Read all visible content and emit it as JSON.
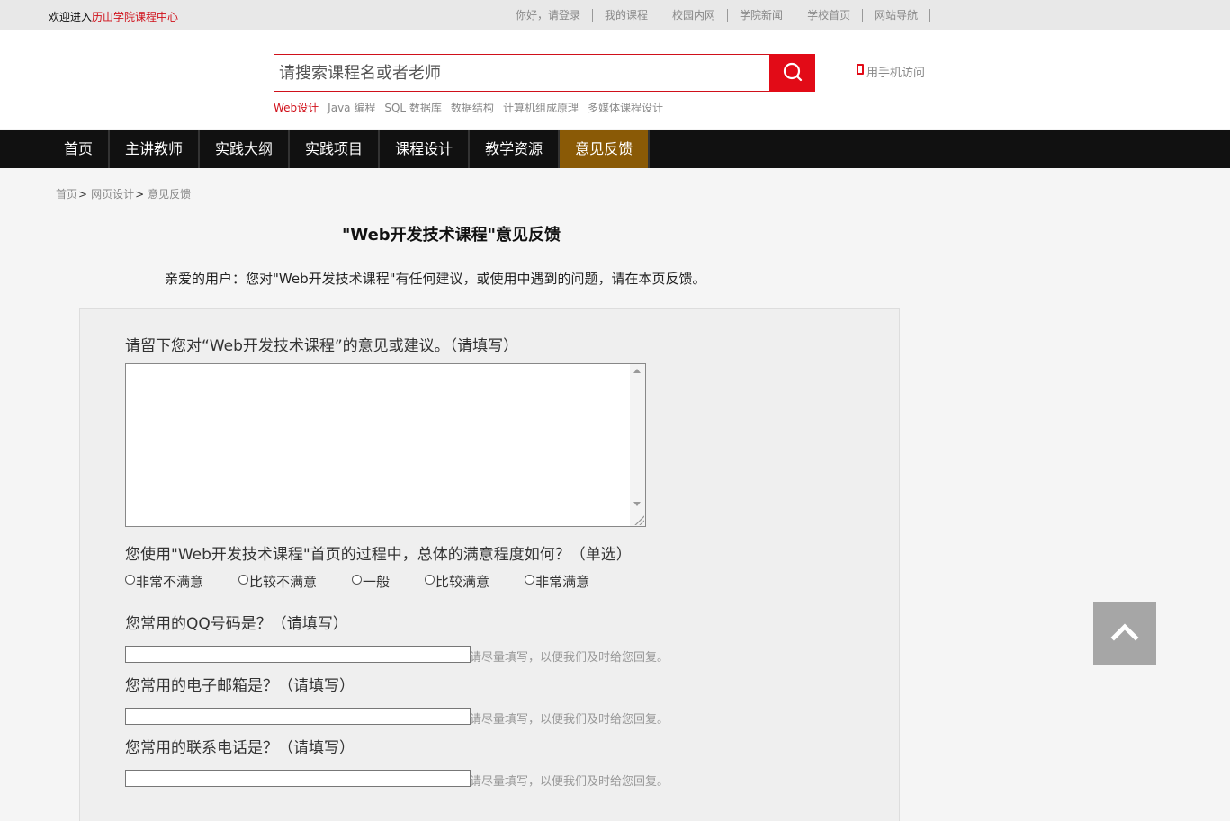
{
  "topbar": {
    "welcome_prefix": "欢迎进入",
    "welcome_highlight": "历山学院课程中心",
    "links": [
      "你好，请登录",
      "我的课程",
      "校园内网",
      "学院新闻",
      "学校首页",
      "网站导航"
    ]
  },
  "header": {
    "search_placeholder": "请搜索课程名或者老师",
    "search_icon": "search-icon",
    "mobile_label": "用手机访问",
    "mobile_icon": "phone-icon",
    "hot_words": [
      "Web设计",
      "Java 编程",
      "SQL 数据库",
      "数据结构",
      "计算机组成原理",
      "多媒体课程设计"
    ]
  },
  "nav": {
    "items": [
      "首页",
      "主讲教师",
      "实践大纲",
      "实践项目",
      "课程设计",
      "教学资源",
      "意见反馈"
    ],
    "active_index": 6
  },
  "breadcrumb": {
    "items": [
      "首页",
      "网页设计",
      "意见反馈"
    ],
    "separator": ">"
  },
  "page": {
    "title": "\"Web开发技术课程\"意见反馈",
    "intro": "亲爱的用户：您对\"Web开发技术课程\"有任何建议，或使用中遇到的问题，请在本页反馈。"
  },
  "form": {
    "q_suggestion": "请留下您对“Web开发技术课程”的意见或建议。（请填写）",
    "q_satisfaction": "您使用\"Web开发技术课程\"首页的过程中，总体的满意程度如何？（单选）",
    "satisfaction_options": [
      "非常不满意",
      "比较不满意",
      "一般",
      "比较满意",
      "非常满意"
    ],
    "q_qq": "您常用的QQ号码是？（请填写）",
    "q_email": "您常用的电子邮箱是？（请填写）",
    "q_phone": "您常用的联系电话是？（请填写）",
    "hint": "请尽量填写，以便我们及时给您回复。"
  },
  "backtop": {
    "icon": "chevron-up-icon"
  },
  "colors": {
    "brand_red": "#e20b17",
    "nav_bg": "#111111",
    "nav_active": "#8a5a06"
  }
}
